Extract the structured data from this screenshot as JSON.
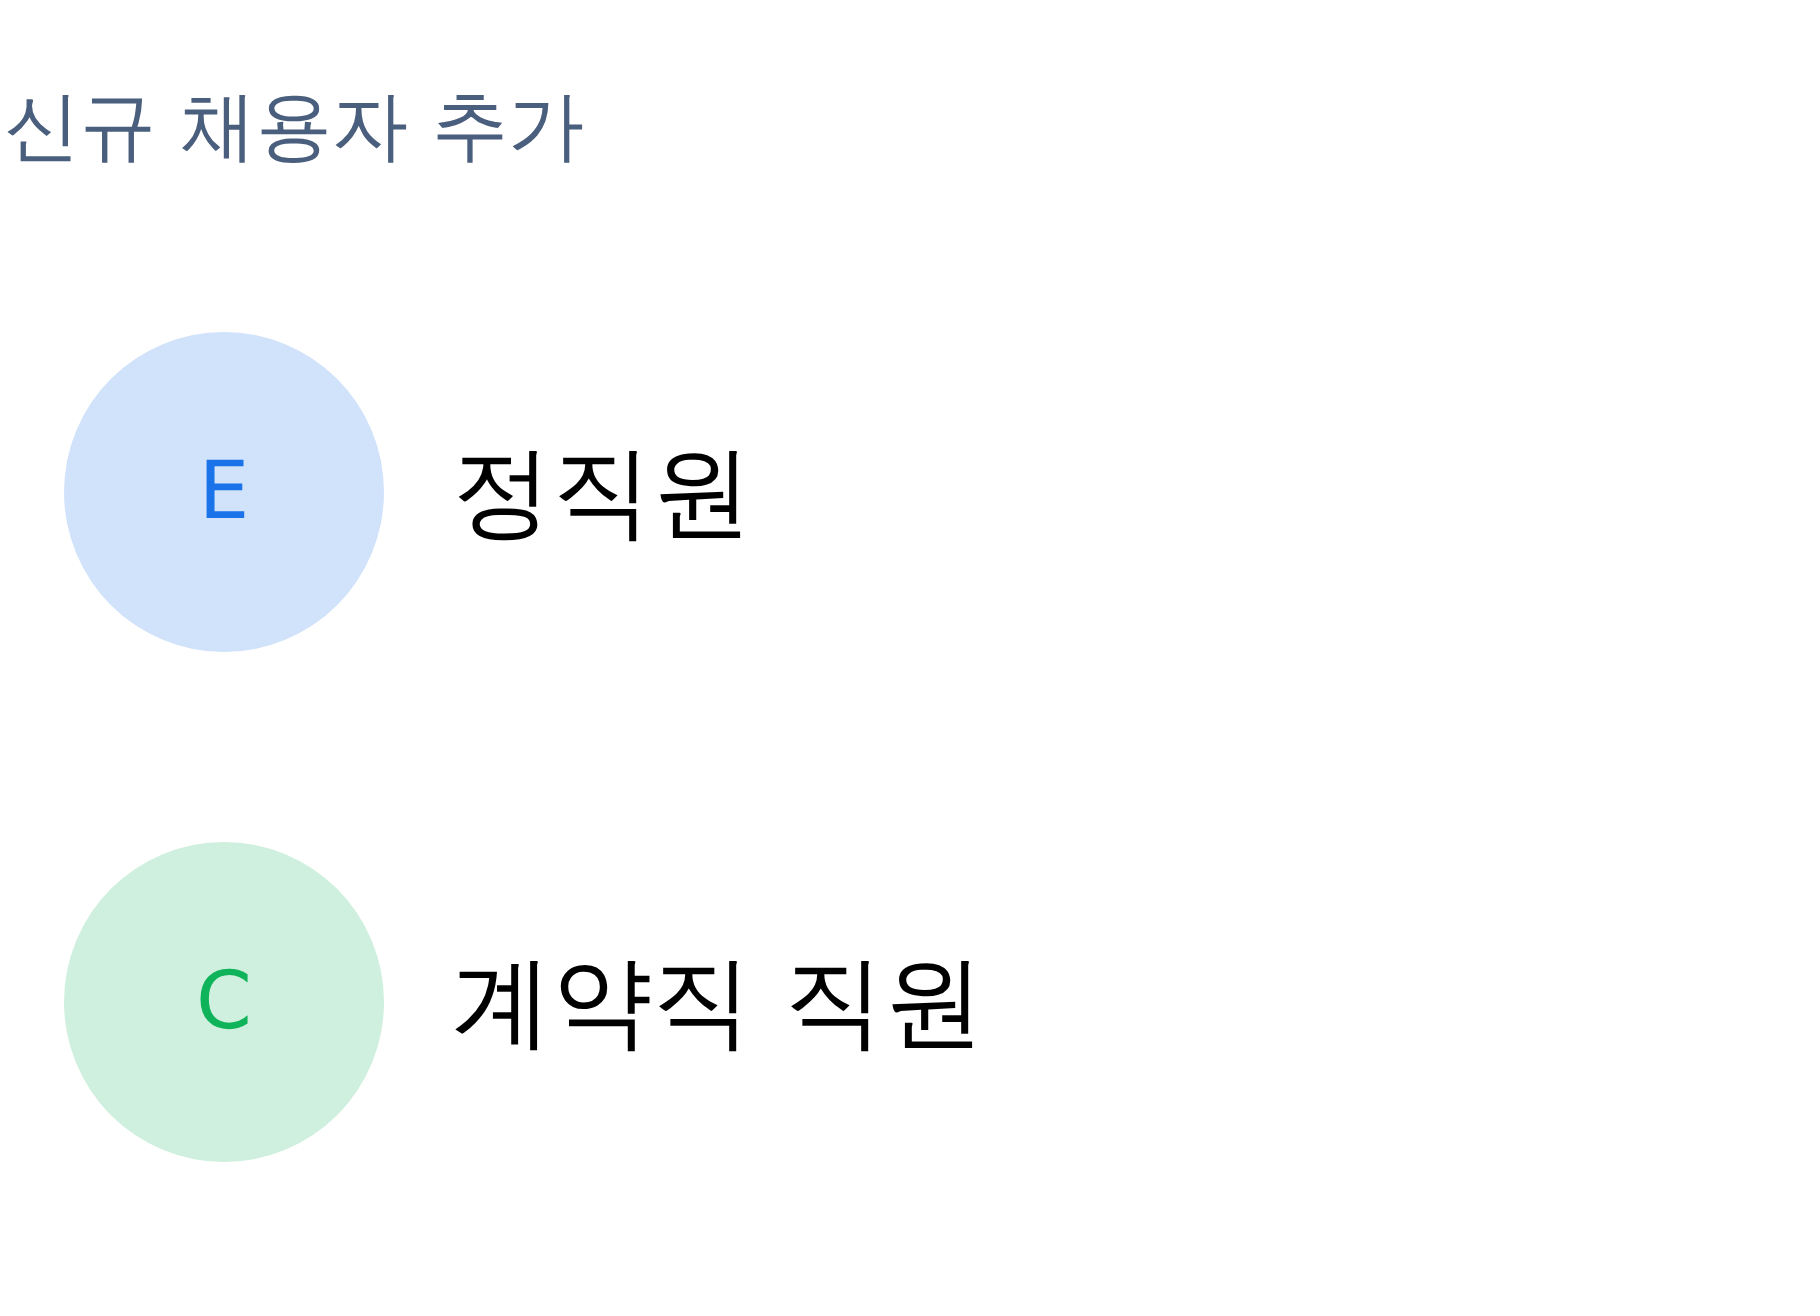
{
  "title": "신규 채용자 추가",
  "options": [
    {
      "avatar": "E",
      "label": "정직원",
      "color": "#1a73e8"
    },
    {
      "avatar": "C",
      "label": "계약직 직원",
      "color": "#0fb45a"
    }
  ]
}
